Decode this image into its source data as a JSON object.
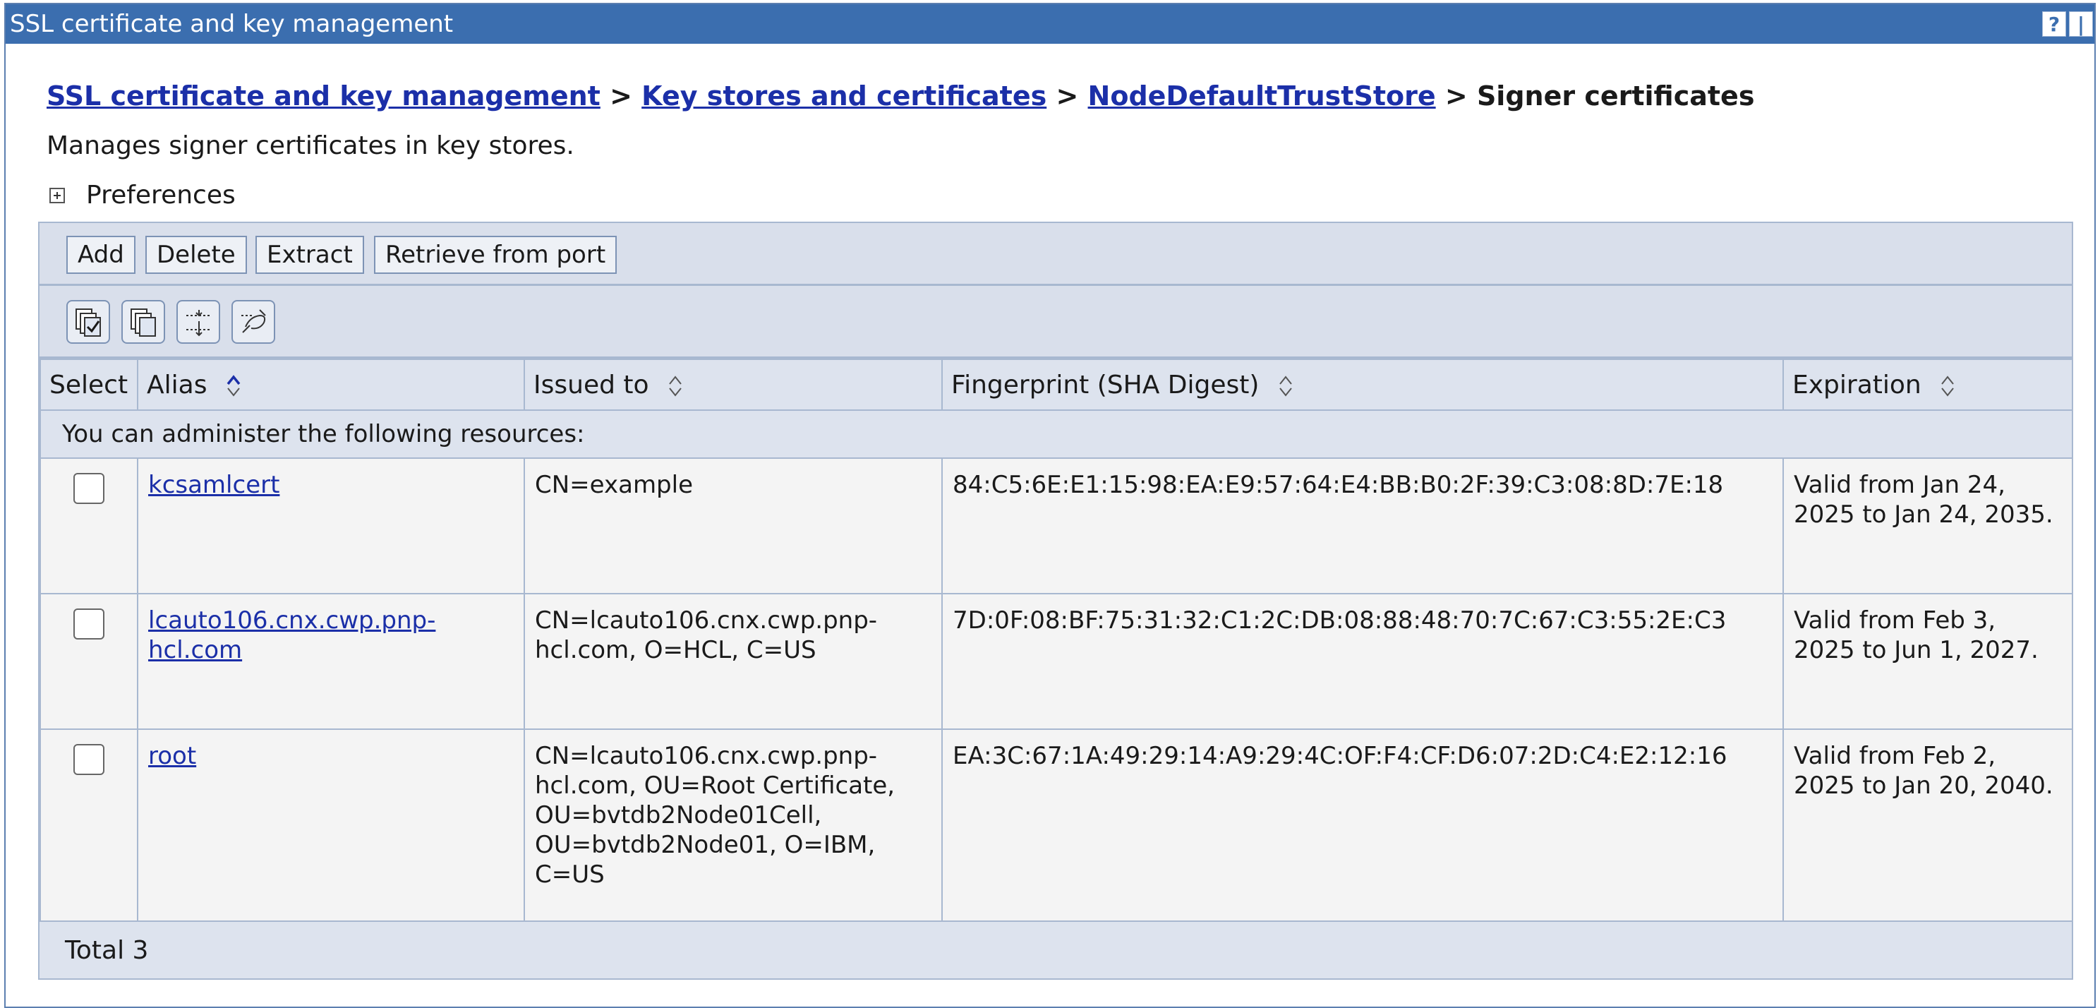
{
  "window": {
    "title": "SSL certificate and key management",
    "help_label": "?",
    "close_label": "|"
  },
  "breadcrumb": {
    "items": [
      "SSL certificate and key management",
      "Key stores and certificates",
      "NodeDefaultTrustStore"
    ],
    "separator": ">",
    "current": "Signer certificates"
  },
  "description": "Manages signer certificates in key stores.",
  "preferences_label": "Preferences",
  "actions": [
    "Add",
    "Delete",
    "Extract",
    "Retrieve from port"
  ],
  "toolbar_icons": [
    "select-all-icon",
    "deselect-all-icon",
    "show-filter-icon",
    "clear-filter-icon"
  ],
  "table": {
    "columns": [
      "Select",
      "Alias",
      "Issued to",
      "Fingerprint (SHA Digest)",
      "Expiration"
    ],
    "admin_message": "You can administer the following resources:",
    "rows": [
      {
        "alias": "kcsamlcert",
        "issued_to": "CN=example",
        "fingerprint": "84:C5:6E:E1:15:98:EA:E9:57:64:E4:BB:B0:2F:39:C3:08:8D:7E:18",
        "expiration": "Valid from Jan 24, 2025 to Jan 24, 2035."
      },
      {
        "alias": "lcauto106.cnx.cwp.pnp-hcl.com",
        "issued_to": "CN=lcauto106.cnx.cwp.pnp-hcl.com, O=HCL, C=US",
        "fingerprint": "7D:0F:08:BF:75:31:32:C1:2C:DB:08:88:48:70:7C:67:C3:55:2E:C3",
        "expiration": "Valid from Feb 3, 2025 to Jun 1, 2027."
      },
      {
        "alias": "root",
        "issued_to": "CN=lcauto106.cnx.cwp.pnp-hcl.com, OU=Root Certificate, OU=bvtdb2Node01Cell, OU=bvtdb2Node01, O=IBM, C=US",
        "fingerprint": "EA:3C:67:1A:49:29:14:A9:29:4C:OF:F4:CF:D6:07:2D:C4:E2:12:16",
        "expiration": "Valid from Feb 2, 2025 to Jan 20, 2040."
      }
    ],
    "total": "Total 3"
  },
  "colors": {
    "titlebar": "#3b6eaf",
    "link": "#1b2fa8",
    "panel": "#dfe4ee",
    "row": "#f4f4f4",
    "border": "#a8b8d0"
  }
}
